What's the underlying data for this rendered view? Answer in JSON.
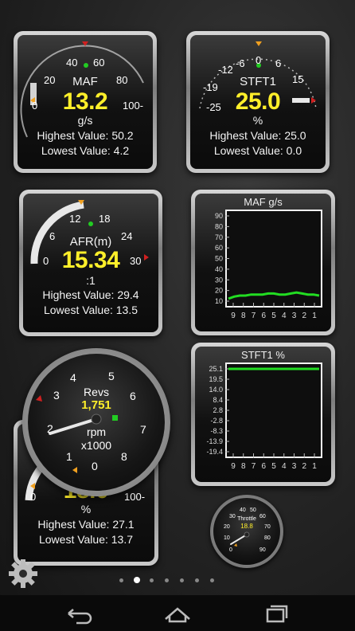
{
  "gauges": {
    "maf": {
      "name": "MAF",
      "value": "13.2",
      "unit": "g/s",
      "ticks": [
        "0",
        "20",
        "40",
        "60",
        "80",
        "100-"
      ],
      "highest": "Highest Value: 50.2",
      "lowest": "Lowest Value: 4.2"
    },
    "stft": {
      "name": "STFT1",
      "value": "25.0",
      "unit": "%",
      "ticks": [
        "-25",
        "-19",
        "-12",
        "-6",
        "0",
        "6",
        "15",
        "25"
      ],
      "highest": "Highest Value: 25.0",
      "lowest": "Lowest Value: 0.0"
    },
    "afr": {
      "name": "AFR(m)",
      "value": "15.34",
      "unit": ":1",
      "ticks": [
        "0",
        "6",
        "12",
        "18",
        "24",
        "30"
      ],
      "highest": "Highest Value: 29.4",
      "lowest": "Lowest Value: 13.5"
    },
    "revs": {
      "name": "Revs",
      "value": "1,751",
      "unit": "rpm",
      "sub": "x1000",
      "ticks": [
        "0",
        "1",
        "2",
        "3",
        "4",
        "5",
        "6",
        "7",
        "8"
      ]
    },
    "hidden": {
      "value": "18.0",
      "unit": "%",
      "ticks": [
        "0",
        "100-"
      ],
      "highest": "Highest Value: 27.1",
      "lowest": "Lowest Value: 13.7"
    },
    "throttle": {
      "name": "Throttle",
      "value": "18.8",
      "ticks": [
        "0",
        "10",
        "20",
        "30",
        "40",
        "50",
        "60",
        "70",
        "80",
        "90"
      ]
    }
  },
  "charts": {
    "maf_chart": {
      "title": "MAF g/s"
    },
    "stft_chart": {
      "title": "STFT1 %"
    }
  },
  "chart_data": [
    {
      "type": "line",
      "title": "MAF g/s",
      "yticks": [
        "90",
        "80",
        "70",
        "60",
        "50",
        "40",
        "30",
        "20",
        "10"
      ],
      "xticks": [
        "9",
        "8",
        "7",
        "6",
        "5",
        "4",
        "3",
        "2",
        "1"
      ],
      "ylim": [
        5,
        92
      ],
      "series": [
        {
          "values": [
            12,
            14,
            15,
            15,
            16,
            16,
            16,
            17,
            17,
            16,
            16,
            17,
            18,
            17,
            16,
            16,
            15
          ]
        }
      ],
      "color": "#22dd22"
    },
    {
      "type": "line",
      "title": "STFT1 %",
      "yticks": [
        "25.1",
        "19.5",
        "14.0",
        "8.4",
        "2.8",
        "-2.8",
        "-8.3",
        "-13.9",
        "-19.4"
      ],
      "xticks": [
        "9",
        "8",
        "7",
        "6",
        "5",
        "4",
        "3",
        "2",
        "1"
      ],
      "ylim": [
        -25,
        25.1
      ],
      "series": [
        {
          "values": [
            25.1,
            25.1,
            25.1,
            25.1,
            25.1,
            25.1,
            25.1,
            25.1,
            25.1
          ]
        }
      ],
      "color": "#22dd22"
    }
  ],
  "pager": {
    "count": 7,
    "active": 1
  },
  "colors": {
    "value": "#ffef2a",
    "accent": "#22dd22",
    "needle": "#e0e0e0"
  }
}
